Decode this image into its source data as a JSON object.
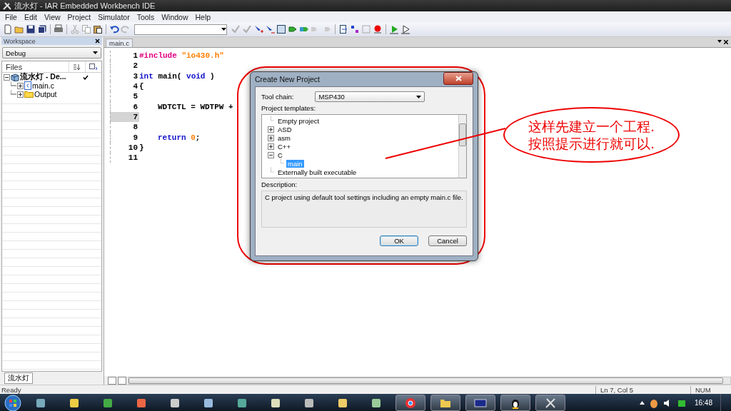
{
  "window": {
    "title": "流水灯 - IAR Embedded Workbench IDE"
  },
  "menu": [
    "File",
    "Edit",
    "View",
    "Project",
    "Simulator",
    "Tools",
    "Window",
    "Help"
  ],
  "workspace": {
    "title": "Workspace",
    "configuration": "Debug",
    "files_header": "Files",
    "tree": [
      {
        "label": "流水灯 - De...",
        "kind": "project",
        "checked": true,
        "expanded": true,
        "children": [
          {
            "label": "main.c",
            "kind": "file",
            "checked": false,
            "expanded": false
          },
          {
            "label": "Output",
            "kind": "folder",
            "checked": false,
            "expanded": false
          }
        ]
      }
    ],
    "bottom_tab": "流水灯"
  },
  "editor": {
    "tab": "main.c",
    "lines": [
      {
        "number": "1",
        "current": false,
        "indented": false,
        "tokens": [
          {
            "text": "#include ",
            "kind": "preproc"
          },
          {
            "text": "\"io430.h\"",
            "kind": "string"
          }
        ]
      },
      {
        "number": "2",
        "current": false
      },
      {
        "number": "3",
        "current": false,
        "indented": false,
        "tokens": [
          {
            "text": "int",
            "kind": "keyword"
          },
          {
            "text": " main( ",
            "kind": "plain"
          },
          {
            "text": "void",
            "kind": "keyword"
          },
          {
            "text": " )",
            "kind": "plain"
          }
        ]
      },
      {
        "number": "4",
        "current": false,
        "indented": false,
        "tokens": [
          {
            "text": "{",
            "kind": "plain"
          }
        ]
      },
      {
        "number": "5",
        "current": false
      },
      {
        "number": "6",
        "current": false,
        "indented": true,
        "tokens": [
          {
            "text": "WDTCTL = WDTPW +",
            "kind": "plain"
          }
        ]
      },
      {
        "number": "7",
        "current": true
      },
      {
        "number": "8",
        "current": false
      },
      {
        "number": "9",
        "current": false,
        "indented": true,
        "tokens": [
          {
            "text": "return ",
            "kind": "keyword"
          },
          {
            "text": "0",
            "kind": "number"
          },
          {
            "text": ";",
            "kind": "plain"
          }
        ]
      },
      {
        "number": "10",
        "current": false,
        "indented": false,
        "tokens": [
          {
            "text": "}",
            "kind": "plain"
          }
        ]
      },
      {
        "number": "11",
        "current": false
      }
    ]
  },
  "dialog": {
    "title": "Create New Project",
    "toolchain_label": "Tool chain:",
    "toolchain": "MSP430",
    "templates_label": "Project templates:",
    "templates": [
      {
        "label": "Empty project",
        "kind": "leaf",
        "selected": false
      },
      {
        "label": "ASD",
        "kind": "group",
        "expanded": false,
        "selected": false
      },
      {
        "label": "asm",
        "kind": "group",
        "expanded": false,
        "selected": false
      },
      {
        "label": "C++",
        "kind": "group",
        "expanded": false,
        "selected": false
      },
      {
        "label": "C",
        "kind": "group",
        "expanded": true,
        "selected": false,
        "children": [
          {
            "label": "main",
            "kind": "leaf",
            "selected": true
          }
        ]
      },
      {
        "label": "Externally built executable",
        "kind": "leaf",
        "selected": false
      }
    ],
    "description_label": "Description:",
    "description": "C project using default tool settings including an empty main.c file.",
    "buttons": [
      "OK",
      "Cancel"
    ]
  },
  "annotation": {
    "lines": [
      "这样先建立一个工程.",
      "按照提示进行就可以."
    ]
  },
  "status_bar": {
    "message": "Ready",
    "position": "Ln 7, Col 5",
    "mode": "NUM"
  },
  "taskbar": {
    "time": "16:48"
  }
}
